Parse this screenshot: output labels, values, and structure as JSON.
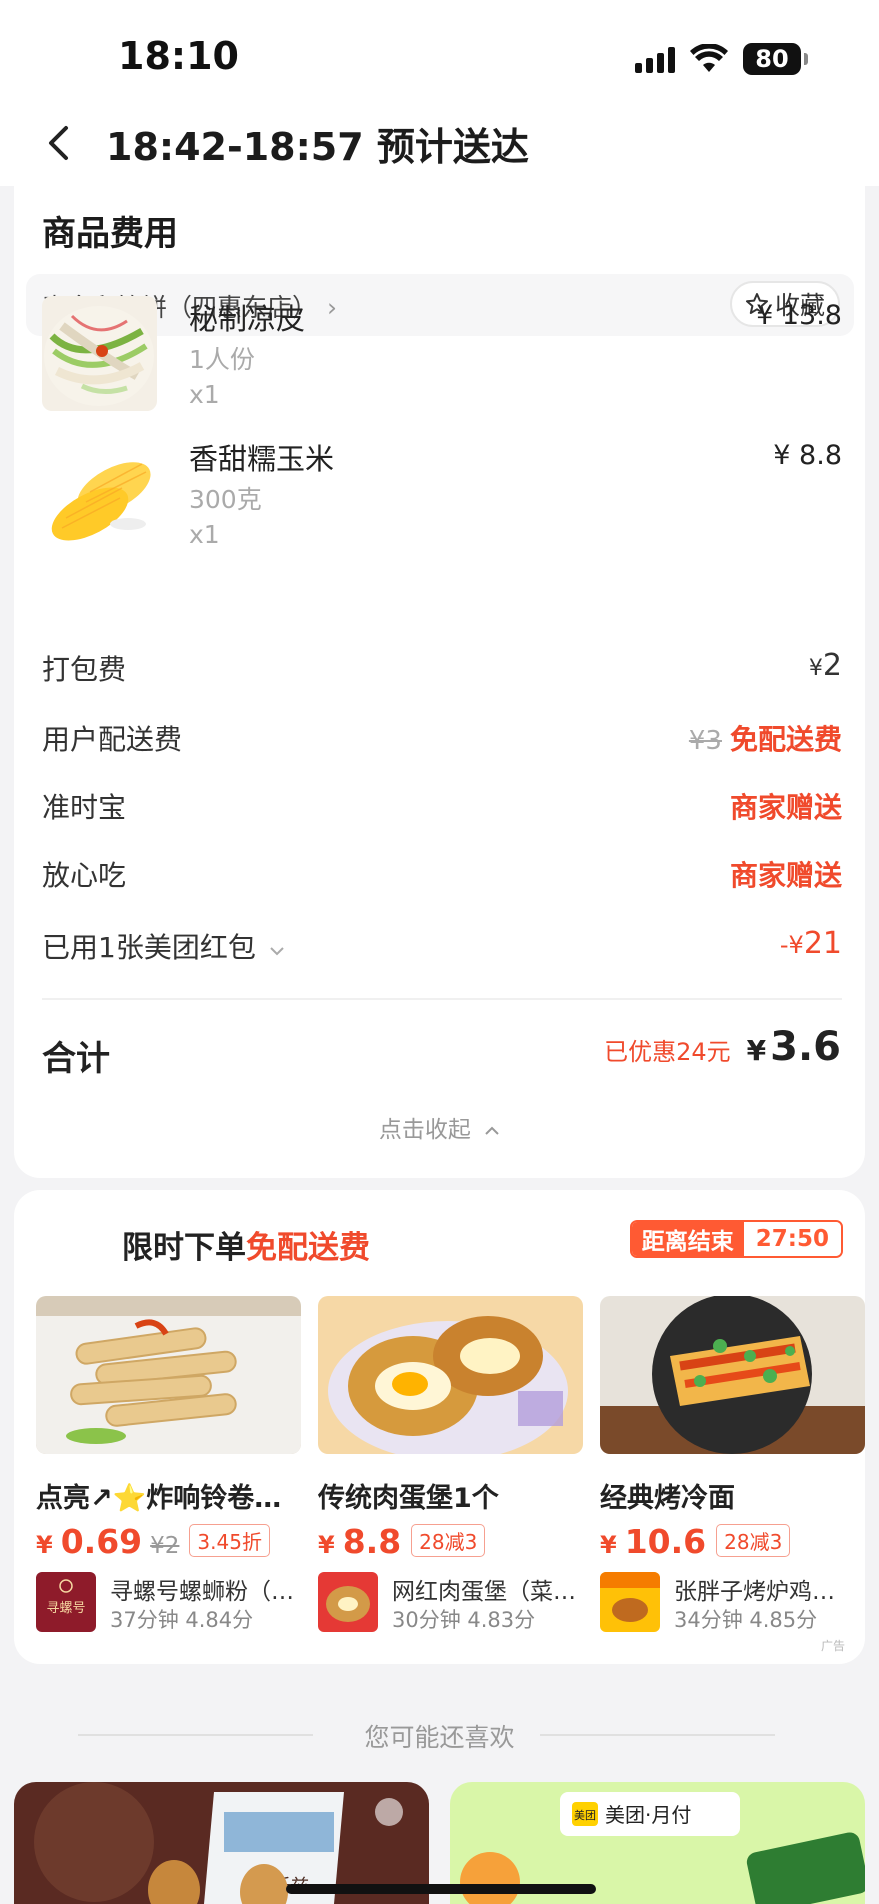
{
  "status_bar": {
    "time": "18:10",
    "battery": "80"
  },
  "nav": {
    "title": "18:42-18:57 预计送达"
  },
  "cost": {
    "section_title": "商品费用",
    "store_name": "麦多和馅饼（四惠东店）",
    "favorite_label": "收藏",
    "items": [
      {
        "name": "秘制凉皮",
        "spec": "1人份",
        "qty": "x1",
        "price": "¥ 13.8"
      },
      {
        "name": "香甜糯玉米",
        "spec": "300克",
        "qty": "x1",
        "price": "¥ 8.8"
      }
    ],
    "fees": {
      "packing_label": "打包费",
      "packing_yen": "¥",
      "packing_value": "2",
      "delivery_label": "用户配送费",
      "delivery_original": "¥3",
      "delivery_value": "免配送费",
      "ontime_label": "准时宝",
      "ontime_value": "商家赠送",
      "safe_label": "放心吃",
      "safe_value": "商家赠送",
      "redpack_label": "已用1张美团红包",
      "redpack_prefix": "-¥",
      "redpack_value": "21"
    },
    "total": {
      "label": "合计",
      "saved": "已优惠24元",
      "yen": "¥",
      "amount": "3.6"
    },
    "collapse_label": "点击收起"
  },
  "promo": {
    "title_prefix": "限时下单",
    "title_highlight": "免配送费",
    "countdown_label": "距离结束",
    "countdown_time": "27:50",
    "products": [
      {
        "title": "点亮↗⭐炸响铃卷…",
        "yen": "¥",
        "price": "0.69",
        "orig": "¥2",
        "tag": "3.45折",
        "shop": "寻螺号螺蛳粉（…",
        "meta": "37分钟  4.84分",
        "logo": "寻螺号"
      },
      {
        "title": "传统肉蛋堡1个",
        "yen": "¥",
        "price": "8.8",
        "orig": "",
        "tag": "28减3",
        "shop": "网红肉蛋堡（菜…",
        "meta": "30分钟  4.83分",
        "logo": ""
      },
      {
        "title": "经典烤冷面",
        "yen": "¥",
        "price": "10.6",
        "orig": "",
        "tag": "28减3",
        "shop": "张胖子烤炉鸡…",
        "meta": "34分钟  4.85分",
        "logo": ""
      }
    ],
    "ad_label": "广告"
  },
  "like": {
    "title": "您可能还喜欢",
    "banner_right_label": "美团·月付",
    "banner_right_brand": "美团",
    "banner_left_pack": "巧乐兹"
  },
  "colors": {
    "accent": "#f04a2c",
    "countdown": "#ff5a33",
    "background": "#f3f3f5"
  }
}
